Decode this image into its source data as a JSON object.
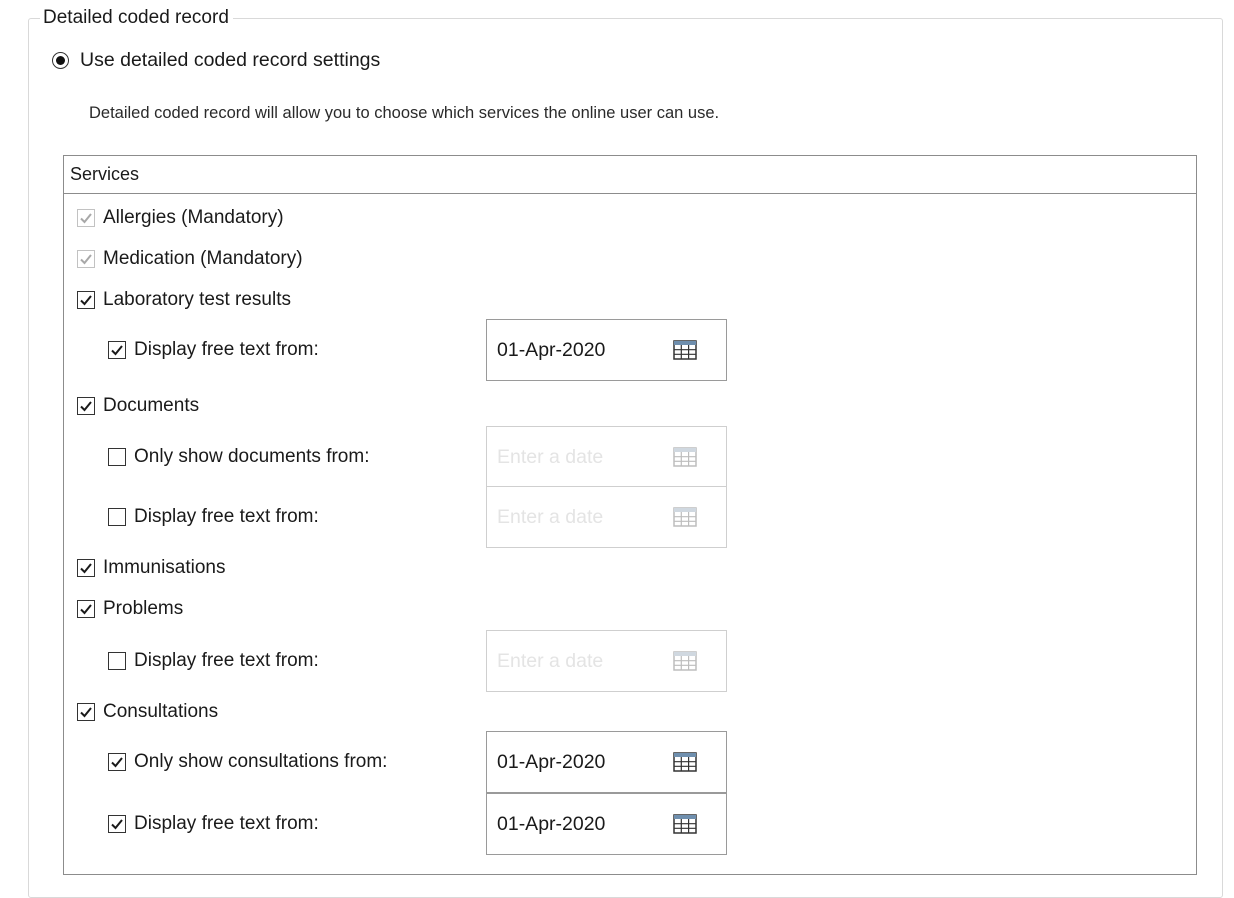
{
  "groupbox": {
    "title": "Detailed coded record"
  },
  "option": {
    "label": "Use detailed coded record settings",
    "selected": true
  },
  "description": "Detailed coded record will allow you to choose which services the online user can use.",
  "services": {
    "header": "Services",
    "allergies": {
      "label": "Allergies (Mandatory)",
      "checked": true,
      "disabled": true
    },
    "medication": {
      "label": "Medication (Mandatory)",
      "checked": true,
      "disabled": true
    },
    "lab": {
      "label": "Laboratory test results",
      "checked": true,
      "free_text": {
        "label": "Display free text from:",
        "checked": true,
        "date": "01-Apr-2020"
      }
    },
    "documents": {
      "label": "Documents",
      "checked": true,
      "only_show": {
        "label": "Only show documents from:",
        "checked": false,
        "placeholder": "Enter a date"
      },
      "free_text": {
        "label": "Display free text from:",
        "checked": false,
        "placeholder": "Enter a date"
      }
    },
    "immunisations": {
      "label": "Immunisations",
      "checked": true
    },
    "problems": {
      "label": "Problems",
      "checked": true,
      "free_text": {
        "label": "Display free text from:",
        "checked": false,
        "placeholder": "Enter a date"
      }
    },
    "consultations": {
      "label": "Consultations",
      "checked": true,
      "only_show": {
        "label": "Only show consultations from:",
        "checked": true,
        "date": "01-Apr-2020"
      },
      "free_text": {
        "label": "Display free text from:",
        "checked": true,
        "date": "01-Apr-2020"
      }
    }
  },
  "icons": {
    "calendar": "calendar-icon",
    "check": "checkmark-icon"
  },
  "colors": {
    "check_enabled": "#1a1a1a",
    "check_disabled": "#a8a8a8",
    "border": "#8c8c8c"
  }
}
